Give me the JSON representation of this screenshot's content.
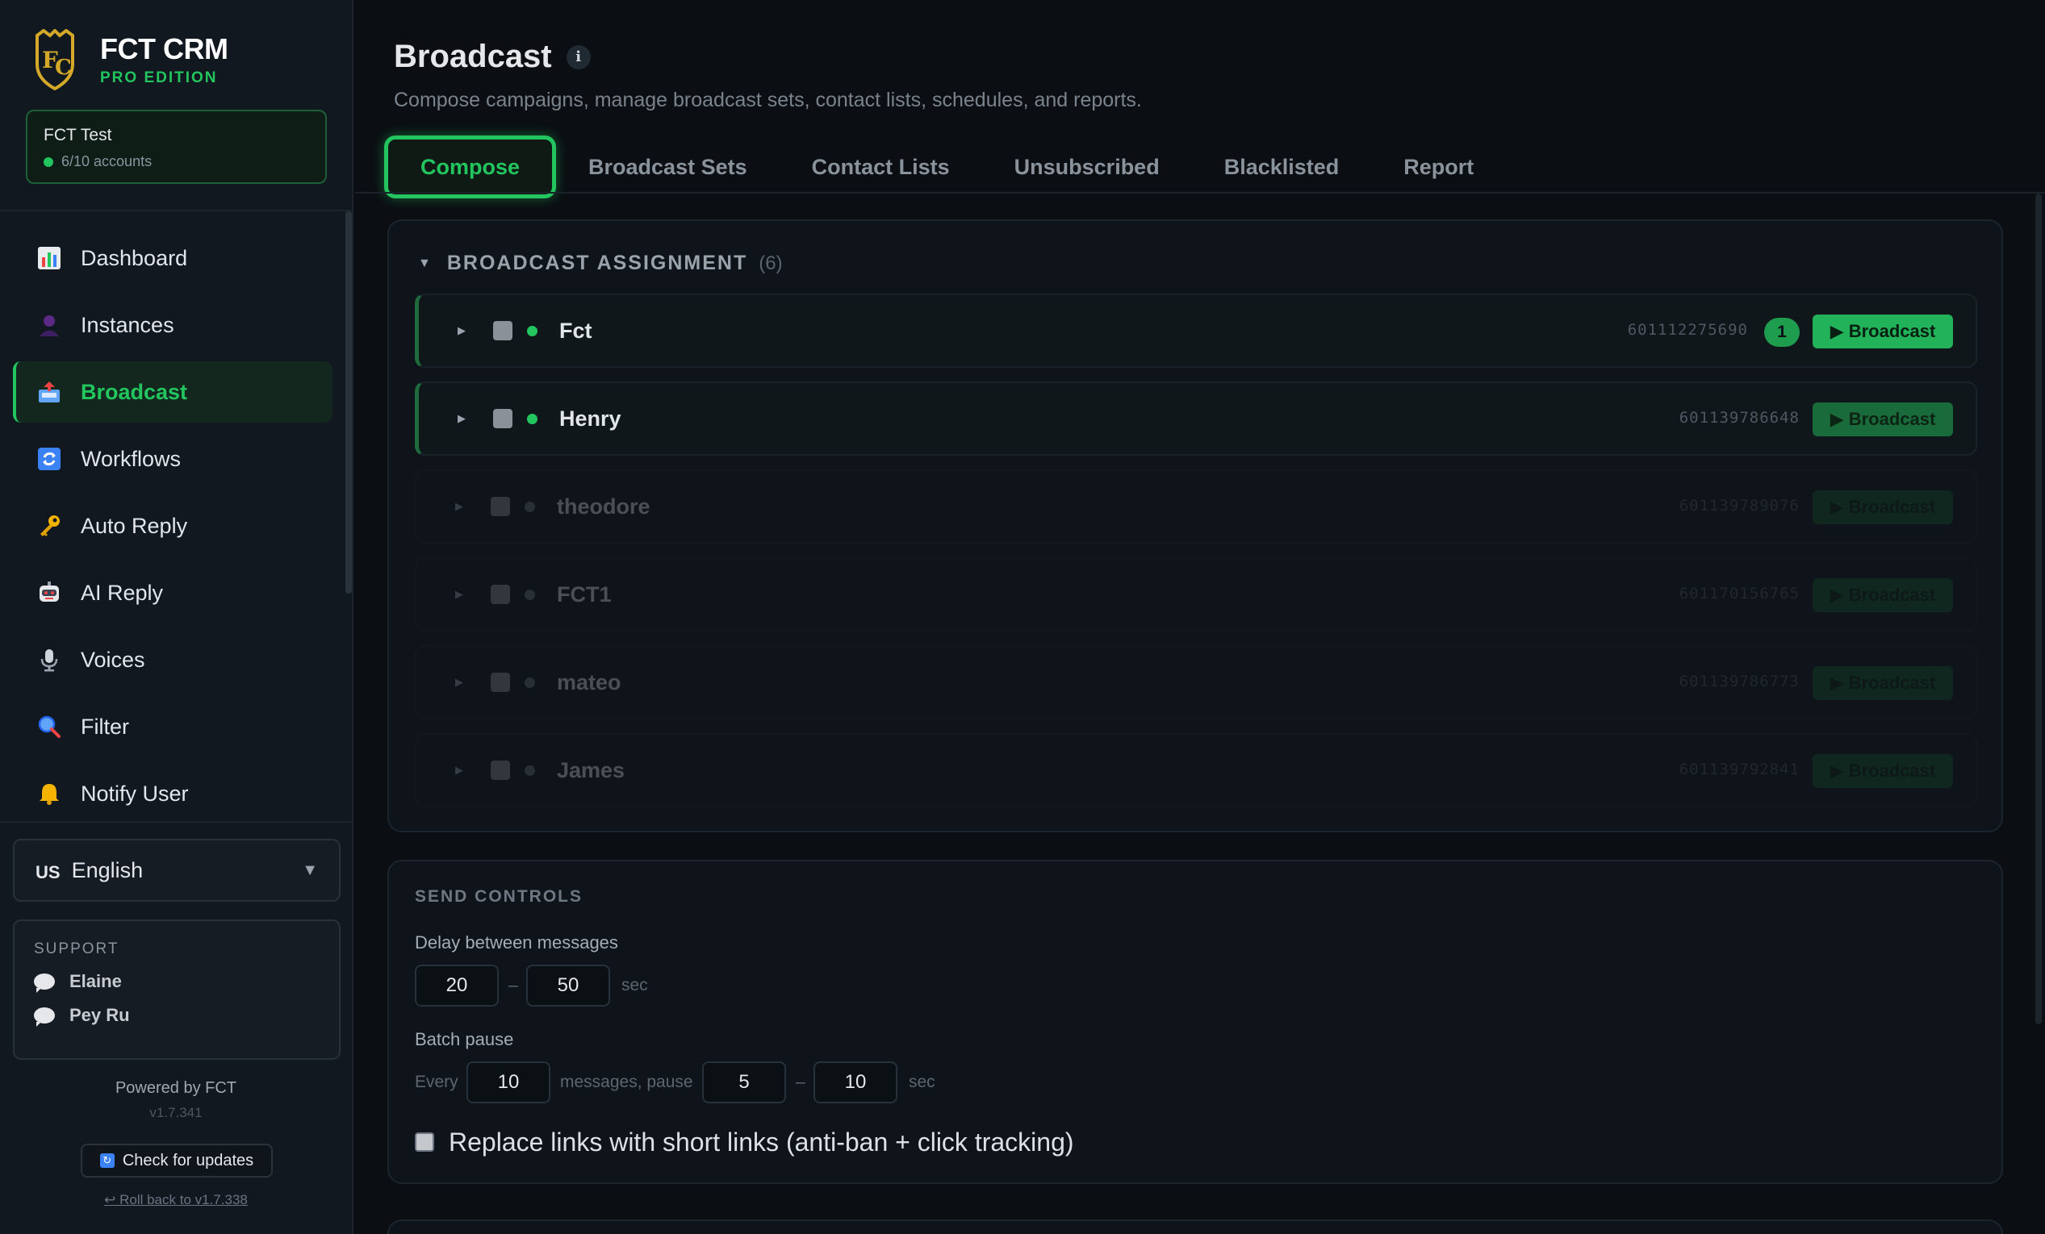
{
  "brand": {
    "name": "FCT CRM",
    "edition": "PRO EDITION"
  },
  "account": {
    "name": "FCT Test",
    "count": "6/10 accounts"
  },
  "nav": [
    {
      "label": "Dashboard",
      "icon": "bar-chart-icon"
    },
    {
      "label": "Instances",
      "icon": "person-icon"
    },
    {
      "label": "Broadcast",
      "icon": "outbox-tray-icon",
      "active": true
    },
    {
      "label": "Workflows",
      "icon": "refresh-arrows-icon"
    },
    {
      "label": "Auto Reply",
      "icon": "key-icon"
    },
    {
      "label": "AI Reply",
      "icon": "robot-icon"
    },
    {
      "label": "Voices",
      "icon": "microphone-icon"
    },
    {
      "label": "Filter",
      "icon": "magnifier-icon"
    },
    {
      "label": "Notify User",
      "icon": "bell-icon"
    }
  ],
  "language": {
    "flag": "US",
    "label": "English"
  },
  "support": {
    "title": "SUPPORT",
    "contacts": [
      "Elaine",
      "Pey Ru"
    ]
  },
  "footer": {
    "powered": "Powered by FCT",
    "version": "v1.7.341",
    "update_label": "Check for updates",
    "rollback_label": "↩ Roll back to v1.7.338"
  },
  "page": {
    "title": "Broadcast",
    "info": "i",
    "subtitle": "Compose campaigns, manage broadcast sets, contact lists, schedules, and reports."
  },
  "tabs": [
    "Compose",
    "Broadcast Sets",
    "Contact Lists",
    "Unsubscribed",
    "Blacklisted",
    "Report"
  ],
  "assignment": {
    "title": "BROADCAST ASSIGNMENT",
    "count": "(6)",
    "button_label": "▶ Broadcast",
    "rows": [
      {
        "name": "Fct",
        "phone": "601112275690",
        "badge": "1",
        "online": true
      },
      {
        "name": "Henry",
        "phone": "601139786648",
        "badge": "",
        "online": true
      },
      {
        "name": "theodore",
        "phone": "601139789076",
        "badge": "",
        "online": false
      },
      {
        "name": "FCT1",
        "phone": "601170156765",
        "badge": "",
        "online": false
      },
      {
        "name": "mateo",
        "phone": "601139786773",
        "badge": "",
        "online": false
      },
      {
        "name": "James",
        "phone": "601139792841",
        "badge": "",
        "online": false
      }
    ]
  },
  "send_controls": {
    "title": "SEND CONTROLS",
    "delay_label": "Delay between messages",
    "delay_min": "20",
    "delay_max": "50",
    "dash": "–",
    "unit": "sec",
    "batch_label": "Batch pause",
    "every_label": "Every",
    "batch_count": "10",
    "messages_pause_label": "messages, pause",
    "pause_min": "5",
    "pause_max": "10",
    "short_links_label": "Replace links with short links (anti-ban + click tracking)"
  },
  "colors": {
    "accent": "#22c55e",
    "background": "#0b0f13",
    "sidebar": "#111820"
  }
}
